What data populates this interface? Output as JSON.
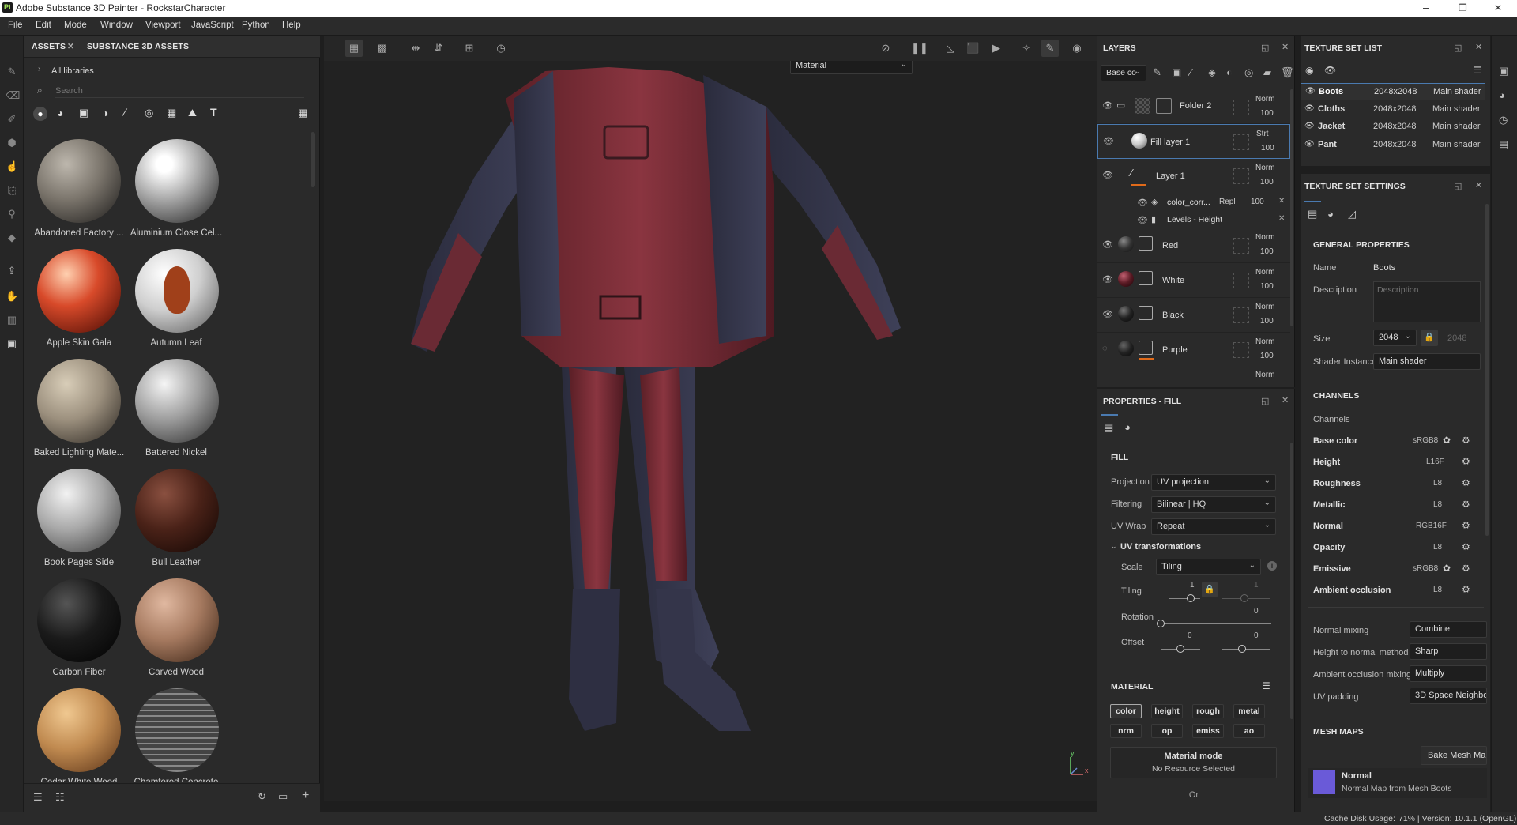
{
  "titlebar": {
    "app_title": "Adobe Substance 3D Painter - RockstarCharacter",
    "minimize": "–",
    "maximize": "❐",
    "close": "✕"
  },
  "menu": [
    "File",
    "Edit",
    "Mode",
    "Window",
    "Viewport",
    "JavaScript",
    "Python",
    "Help"
  ],
  "assets": {
    "tab_assets": "ASSETS",
    "tab_close": "✕",
    "tab_substance": "SUBSTANCE 3D ASSETS",
    "all_libraries": "All libraries",
    "search_placeholder": "Search",
    "materials": [
      {
        "name": "Abandoned Factory ..."
      },
      {
        "name": "Aluminium Close Cel..."
      },
      {
        "name": "Apple Skin Gala"
      },
      {
        "name": "Autumn Leaf"
      },
      {
        "name": "Baked Lighting Mate..."
      },
      {
        "name": "Battered Nickel"
      },
      {
        "name": "Book Pages Side"
      },
      {
        "name": "Bull Leather"
      },
      {
        "name": "Carbon Fiber"
      },
      {
        "name": "Carved Wood"
      },
      {
        "name": "Cedar White Wood"
      },
      {
        "name": "Chamfered Concrete"
      }
    ]
  },
  "viewport": {
    "mode_select": "Material",
    "axis_y": "y",
    "axis_x": "x"
  },
  "layers": {
    "title": "LAYERS",
    "channel_select": "Base co",
    "rows": [
      {
        "name": "Folder 2",
        "blend": "Norm",
        "opacity": "100"
      },
      {
        "name": "Fill layer 1",
        "blend": "Strt",
        "opacity": "100"
      },
      {
        "name": "Layer 1",
        "blend": "Norm",
        "opacity": "100"
      },
      {
        "name": "Red",
        "blend": "Norm",
        "opacity": "100"
      },
      {
        "name": "White",
        "blend": "Norm",
        "opacity": "100"
      },
      {
        "name": "Black",
        "blend": "Norm",
        "opacity": "100"
      },
      {
        "name": "Purple",
        "blend": "Norm",
        "opacity": "100"
      }
    ],
    "effects": [
      {
        "name": "color_corr...",
        "blend": "Repl",
        "opacity": "100"
      },
      {
        "name": "Levels - Height"
      }
    ],
    "partial_blend": "Norm"
  },
  "properties": {
    "title": "PROPERTIES - FILL",
    "fill_section": "FILL",
    "projection_label": "Projection",
    "projection_value": "UV projection",
    "filtering_label": "Filtering",
    "filtering_value": "Bilinear | HQ",
    "uvwrap_label": "UV Wrap",
    "uvwrap_value": "Repeat",
    "uvtransform_label": "UV transformations",
    "scale_label": "Scale",
    "scale_value": "Tiling",
    "tiling_label": "Tiling",
    "tiling_value": "1",
    "tiling_value2": "1",
    "rotation_label": "Rotation",
    "rotation_value": "0",
    "offset_label": "Offset",
    "offset_x": "0",
    "offset_y": "0",
    "material_section": "MATERIAL",
    "channels": [
      "color",
      "height",
      "rough",
      "metal",
      "nrm",
      "op",
      "emiss",
      "ao"
    ],
    "material_mode": "Material mode",
    "no_resource": "No Resource Selected",
    "or": "Or"
  },
  "texture_set_list": {
    "title": "TEXTURE SET LIST",
    "rows": [
      {
        "name": "Boots",
        "size": "2048x2048",
        "shader": "Main shader"
      },
      {
        "name": "Cloths",
        "size": "2048x2048",
        "shader": "Main shader"
      },
      {
        "name": "Jacket",
        "size": "2048x2048",
        "shader": "Main shader"
      },
      {
        "name": "Pant",
        "size": "2048x2048",
        "shader": "Main shader"
      }
    ]
  },
  "texture_set_settings": {
    "title": "TEXTURE SET SETTINGS",
    "general": "GENERAL PROPERTIES",
    "name_label": "Name",
    "name_value": "Boots",
    "desc_label": "Description",
    "desc_placeholder": "Description",
    "size_label": "Size",
    "size_value": "2048",
    "size_locked": "2048",
    "shader_label": "Shader Instance",
    "shader_value": "Main shader",
    "channels_section": "CHANNELS",
    "channels_label": "Channels",
    "channels": [
      {
        "name": "Base color",
        "format": "sRGB8"
      },
      {
        "name": "Height",
        "format": "L16F"
      },
      {
        "name": "Roughness",
        "format": "L8"
      },
      {
        "name": "Metallic",
        "format": "L8"
      },
      {
        "name": "Normal",
        "format": "RGB16F"
      },
      {
        "name": "Opacity",
        "format": "L8"
      },
      {
        "name": "Emissive",
        "format": "sRGB8"
      },
      {
        "name": "Ambient occlusion",
        "format": "L8"
      }
    ],
    "normal_mixing_label": "Normal mixing",
    "normal_mixing_value": "Combine",
    "h2n_label": "Height to normal method",
    "h2n_value": "Sharp",
    "ao_mixing_label": "Ambient occlusion mixing",
    "ao_mixing_value": "Multiply",
    "uv_padding_label": "UV padding",
    "uv_padding_value": "3D Space Neighbo",
    "mesh_maps": "MESH MAPS",
    "bake_button": "Bake Mesh Ma",
    "normal_map_title": "Normal",
    "normal_map_desc": "Normal Map from Mesh Boots"
  },
  "status": {
    "cache": "Cache Disk Usage:",
    "info": "71% | Version: 10.1.1 (OpenGL)"
  }
}
